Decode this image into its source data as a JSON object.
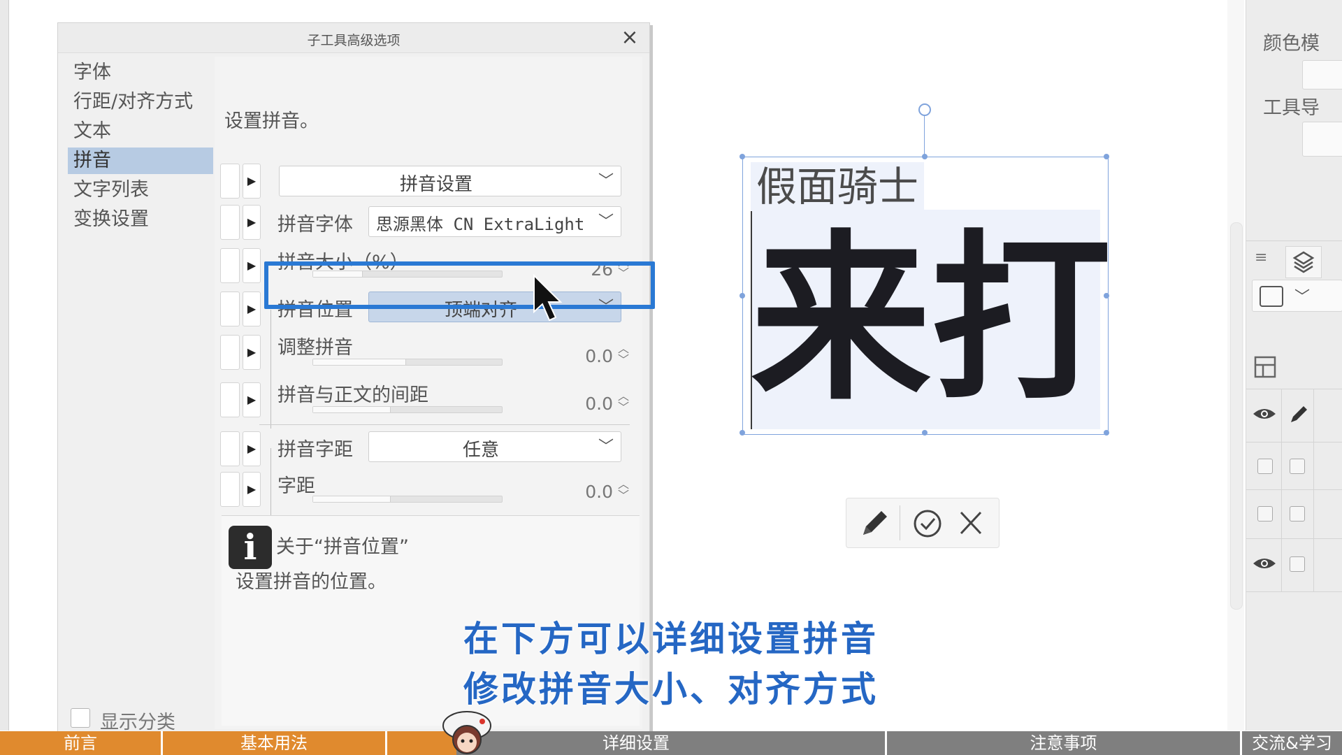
{
  "dialog": {
    "title": "子工具高级选项",
    "close_glyph": "×",
    "categories": [
      {
        "label": "字体"
      },
      {
        "label": "行距/对齐方式"
      },
      {
        "label": "文本"
      },
      {
        "label": "拼音",
        "selected": true
      },
      {
        "label": "文字列表"
      },
      {
        "label": "变换设置"
      }
    ],
    "show_category_label": "显示分类",
    "description": "设置拼音。",
    "rows": {
      "ruby_settings": {
        "value": "拼音设置"
      },
      "ruby_font": {
        "label": "拼音字体",
        "value": "思源黑体 CN ExtraLight"
      },
      "ruby_size": {
        "label": "拼音大小（%）",
        "value": "26",
        "level_percent": 26
      },
      "ruby_position": {
        "label": "拼音位置",
        "value": "顶端对齐"
      },
      "adjust_ruby": {
        "label": "调整拼音",
        "value": "0.0"
      },
      "ruby_gap": {
        "label": "拼音与正文的间距",
        "value": "0.0"
      },
      "ruby_spacing": {
        "label": "拼音字距",
        "value": "任意"
      },
      "char_spacing": {
        "label": "字距",
        "value": "0.0"
      }
    },
    "info": {
      "icon_glyph": "i",
      "title": "关于“拼音位置”",
      "body": "设置拼音的位置。"
    }
  },
  "canvas": {
    "ruby_text": "假面骑士",
    "main_text": "来打"
  },
  "right_panel": {
    "color_label": "颜色模",
    "tool_label": "工具导"
  },
  "subtitles": {
    "line1": "在下方可以详细设置拼音",
    "line2": "修改拼音大小、对齐方式"
  },
  "chapters": [
    {
      "label": "前言"
    },
    {
      "label": "基本用法"
    },
    {
      "label": "详细设置"
    },
    {
      "label": "注意事项"
    },
    {
      "label": "交流&学习"
    }
  ],
  "video_progress_percent": 34,
  "colors": {
    "highlight": "#2a79d4",
    "subtitle": "#2567c4",
    "progress": "#e08a2e",
    "selected_category": "#b7cbe3"
  }
}
